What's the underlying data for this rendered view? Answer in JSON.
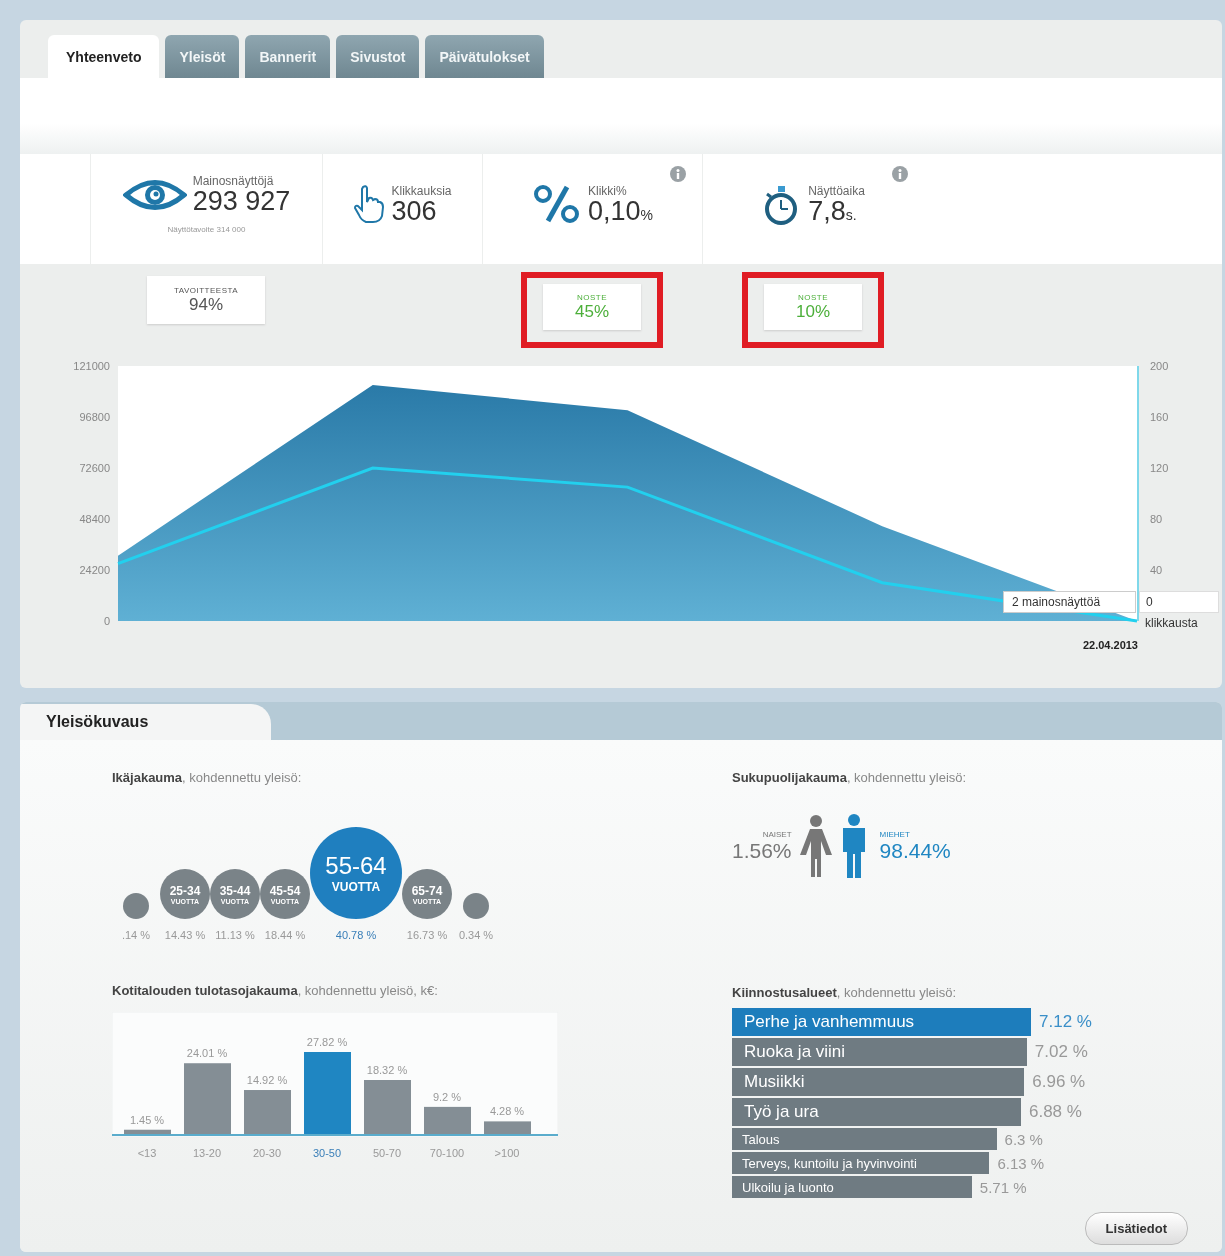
{
  "tabs": [
    {
      "label": "Yhteenveto",
      "selected": true
    },
    {
      "label": "Yleisöt",
      "selected": false
    },
    {
      "label": "Bannerit",
      "selected": false
    },
    {
      "label": "Sivustot",
      "selected": false
    },
    {
      "label": "Päivätulokset",
      "selected": false
    }
  ],
  "stats": [
    {
      "kind": "views",
      "label": "Mainosnäyttöjä",
      "value": "293 927",
      "note": "Näyttötavoite 314 000",
      "info": false,
      "badge": {
        "label": "TAVOITTEESTA",
        "value": "94%",
        "highlighted": false
      }
    },
    {
      "kind": "clicks",
      "label": "Klikkauksia",
      "value": "306",
      "info": false
    },
    {
      "kind": "rate",
      "label": "Klikki%",
      "value": "0,10",
      "unit": "%",
      "info": true,
      "badge": {
        "label": "NOSTE",
        "value": "45%",
        "highlighted": true
      }
    },
    {
      "kind": "time",
      "label": "Näyttöaika",
      "value": "7,8",
      "unit": "s.",
      "info": true,
      "badge": {
        "label": "NOSTE",
        "value": "10%",
        "highlighted": true
      }
    }
  ],
  "trend": {
    "chart_data": {
      "type": "area",
      "ylim": [
        0,
        121000
      ],
      "y2lim": [
        0,
        200
      ],
      "y2ticks": [
        {
          "value": 200,
          "label": "200"
        },
        {
          "value": 160,
          "label": "160"
        },
        {
          "value": 120,
          "label": "120"
        },
        {
          "value": 80,
          "label": "80"
        },
        {
          "value": 40,
          "label": "40"
        }
      ],
      "yticks": [
        {
          "value": 0,
          "label": "0"
        },
        {
          "value": 24200,
          "label": "24200"
        },
        {
          "value": 48400,
          "label": "48400"
        },
        {
          "value": 72600,
          "label": "72600"
        },
        {
          "value": 96800,
          "label": "96800"
        },
        {
          "value": 121000,
          "label": "121000"
        }
      ],
      "series": [
        {
          "color": "#2a7aa8",
          "values": [
            31000,
            112000,
            100000,
            45000,
            0
          ]
        },
        {
          "color": "#22d0ee",
          "axis": "y2",
          "type": "line",
          "values": [
            45,
            120,
            105,
            30,
            0
          ]
        }
      ]
    },
    "date_label": "22.04.2013",
    "tooltip": {
      "impressions": "2 mainosnäyttöä",
      "clicks_value": "0",
      "clicks_label": "klikkausta"
    }
  },
  "audience": {
    "tab": "Yleisökuvaus",
    "age": {
      "title": "Ikäjakauma",
      "subtitle": ", kohdennettu yleisö:",
      "groups": [
        {
          "kind": "small",
          "share": ".14 %",
          "selected": false
        },
        {
          "kind": "medium",
          "range": "25-34",
          "unit": "VUOTTA",
          "share": "14.43 %",
          "selected": false
        },
        {
          "kind": "medium",
          "range": "35-44",
          "unit": "VUOTTA",
          "share": "11.13 %",
          "selected": false
        },
        {
          "kind": "medium",
          "range": "45-54",
          "unit": "VUOTTA",
          "share": "18.44 %",
          "selected": false
        },
        {
          "kind": "large",
          "range": "55-64",
          "unit": "VUOTTA",
          "share": "40.78 %",
          "selected": true
        },
        {
          "kind": "medium",
          "range": "65-74",
          "unit": "VUOTTA",
          "share": "16.73 %",
          "selected": false
        },
        {
          "kind": "small",
          "share": "0.34 %",
          "selected": false
        }
      ]
    },
    "gender": {
      "title": "Sukupuolijakauma",
      "subtitle": ", kohdennettu yleisö:",
      "women": {
        "label": "NAISET",
        "share": "1.56%"
      },
      "men": {
        "label": "MIEHET",
        "share": "98.44%"
      }
    },
    "income": {
      "title": "Kotitalouden tulotasojakauma",
      "subtitle": ", kohdennettu yleisö, k€:",
      "chart_data": {
        "type": "bar",
        "categories": [
          "<13",
          "13-20",
          "20-30",
          "30-50",
          "50-70",
          "70-100",
          ">100"
        ],
        "values": [
          1.45,
          24.01,
          14.92,
          27.82,
          18.32,
          9.2,
          4.28
        ],
        "value_labels": [
          "1.45 %",
          "24.01 %",
          "14.92 %",
          "27.82 %",
          "18.32 %",
          "9.2 %",
          "4.28 %"
        ]
      },
      "bars": [
        {
          "selected": false
        },
        {
          "selected": false
        },
        {
          "selected": false
        },
        {
          "selected": true
        },
        {
          "selected": false
        },
        {
          "selected": false
        },
        {
          "selected": false
        }
      ]
    },
    "interests": {
      "title": "Kiinnostusalueet",
      "subtitle": ", kohdennettu yleisö:",
      "items": [
        {
          "label": "Perhe ja vanhemmuus",
          "share": "7.12 %",
          "kind": "large",
          "selected": true
        },
        {
          "label": "Ruoka ja viini",
          "share": "7.02 %",
          "kind": "large",
          "selected": false
        },
        {
          "label": "Musiikki",
          "share": "6.96 %",
          "kind": "large",
          "selected": false
        },
        {
          "label": "Työ ja ura",
          "share": "6.88 %",
          "kind": "large",
          "selected": false
        },
        {
          "label": "Talous",
          "share": "6.3 %",
          "kind": "small",
          "selected": false
        },
        {
          "label": "Terveys, kuntoilu ja hyvinvointi",
          "share": "6.13 %",
          "kind": "small",
          "selected": false
        },
        {
          "label": "Ulkoilu ja luonto",
          "share": "5.71 %",
          "kind": "small",
          "selected": false
        }
      ]
    },
    "more_button": "Lisätiedot"
  }
}
